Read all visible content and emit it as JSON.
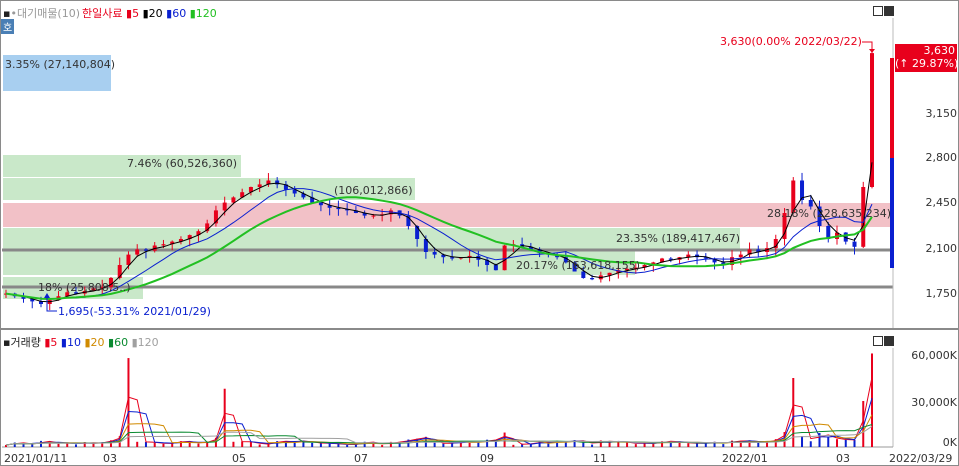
{
  "price_chart": {
    "legend": {
      "prefix": "▪",
      "stock": "•대기매물(10)",
      "name": "한일사료",
      "ma": [
        {
          "label": "5",
          "color": "#e8001c"
        },
        {
          "label": "20",
          "color": "#000000"
        },
        {
          "label": "60",
          "color": "#0a20d0"
        },
        {
          "label": "120",
          "color": "#22c022"
        }
      ]
    },
    "side_tab": "호",
    "top_box": "3.35% (27,140,804)",
    "profile_labels": [
      {
        "text": "7.46% (60,526,360)"
      },
      {
        "text": "(106,012,866)"
      },
      {
        "text": "28.18% (228,635,234)"
      },
      {
        "text": "23.35% (189,417,467)"
      },
      {
        "text": "20.17% (163,618,155)"
      },
      {
        "text": "18% (25,808,5..)"
      }
    ],
    "high_annotation": "3,630(0.00% 2022/03/22)",
    "low_annotation": "1,695(-53.31% 2021/01/29)",
    "current_price_box": {
      "price": "3,630",
      "change": "(↑ 29.87%)"
    },
    "y_ticks": [
      "3,150",
      "2,800",
      "2,450",
      "2,100",
      "1,750"
    ]
  },
  "volume_chart": {
    "legend": {
      "prefix": "▪",
      "name": "거래량",
      "ma": [
        {
          "label": "5",
          "color": "#e8001c"
        },
        {
          "label": "10",
          "color": "#0a20d0"
        },
        {
          "label": "20",
          "color": "#d08a00"
        },
        {
          "label": "60",
          "color": "#0a8a30"
        },
        {
          "label": "120",
          "color": "#a0a0a0"
        }
      ]
    },
    "y_ticks": [
      "60,000K",
      "30,000K",
      "0K"
    ]
  },
  "x_axis": [
    "2021/01/11",
    "03",
    "05",
    "07",
    "09",
    "11",
    "2022/01",
    "03",
    "2022/03/29"
  ],
  "chart_data": {
    "type": "candlestick",
    "ticker_name": "한일사료",
    "price_axis_ticks": [
      3150,
      2800,
      2450,
      2100,
      1750
    ],
    "volume_axis_ticks": [
      "60,000K",
      "30,000K",
      "0K"
    ],
    "period": [
      "2021/01/11",
      "2022/03/29"
    ],
    "current_price": 3630,
    "change_pct": 29.87,
    "high": {
      "price": 3630,
      "pct": 0.0,
      "date": "2022/03/22"
    },
    "low": {
      "price": 1695,
      "pct": -53.31,
      "date": "2021/01/29"
    },
    "volume_profile": [
      {
        "pct": 3.35,
        "volume": 27140804
      },
      {
        "pct": 7.46,
        "volume": 60526360
      },
      {
        "volume": 106012866
      },
      {
        "pct": 28.18,
        "volume": 228635234
      },
      {
        "pct": 23.35,
        "volume": 189417467
      },
      {
        "pct": 20.17,
        "volume": 163618155
      }
    ],
    "close_series": [
      1780,
      1760,
      1740,
      1720,
      1700,
      1730,
      1760,
      1790,
      1780,
      1800,
      1820,
      1830,
      1900,
      2000,
      2080,
      2120,
      2110,
      2150,
      2160,
      2180,
      2200,
      2230,
      2260,
      2320,
      2420,
      2480,
      2520,
      2560,
      2600,
      2620,
      2650,
      2620,
      2580,
      2550,
      2520,
      2480,
      2460,
      2440,
      2430,
      2420,
      2400,
      2380,
      2380,
      2390,
      2420,
      2380,
      2300,
      2200,
      2100,
      2080,
      2060,
      2050,
      2060,
      2070,
      2040,
      2000,
      1960,
      2150,
      2160,
      2140,
      2120,
      2090,
      2080,
      2060,
      2020,
      1950,
      1900,
      1890,
      1920,
      1940,
      1960,
      1970,
      1980,
      2000,
      2020,
      2050,
      2040,
      2060,
      2080,
      2060,
      2050,
      2020,
      2000,
      2060,
      2080,
      2120,
      2100,
      2130,
      2200,
      2400,
      2650,
      2500,
      2450,
      2300,
      2200,
      2250,
      2180,
      2140,
      2600,
      3630
    ]
  }
}
